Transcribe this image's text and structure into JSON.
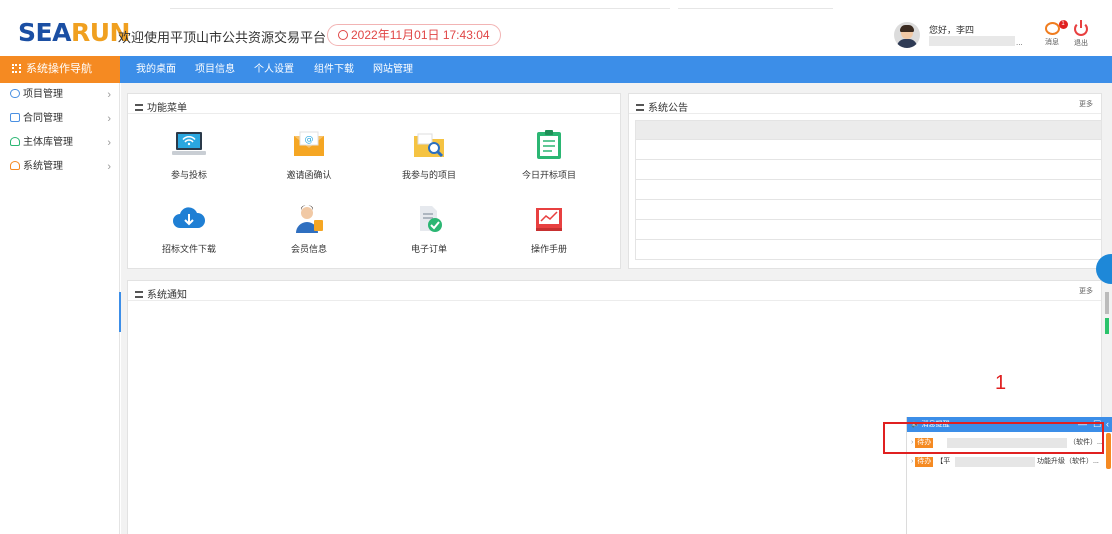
{
  "header": {
    "logo_part1": "SEA",
    "logo_part2": "RUN",
    "welcome": "欢迎使用平顶山市公共资源交易平台",
    "datetime": "2022年11月01日 17:43:04",
    "greeting": "您好，李四",
    "name_suffix": "...",
    "msg_label": "消息",
    "msg_badge": "1",
    "exit_label": "退出"
  },
  "nav": {
    "sidebar_title": "系统操作导航",
    "items": [
      "我的桌面",
      "项目信息",
      "个人设置",
      "组件下载",
      "网站管理"
    ]
  },
  "sidebar": {
    "items": [
      {
        "label": "项目管理",
        "icon": "chat-icon",
        "color": "#4a90e2"
      },
      {
        "label": "合同管理",
        "icon": "document-icon",
        "color": "#4a90e2"
      },
      {
        "label": "主体库管理",
        "icon": "user-icon",
        "color": "#2bb673"
      },
      {
        "label": "系统管理",
        "icon": "users-icon",
        "color": "#f58a22"
      }
    ]
  },
  "function_menu": {
    "title": "功能菜单",
    "tiles": [
      {
        "label": "参与投标",
        "icon": "laptop-wifi-icon"
      },
      {
        "label": "邀请函确认",
        "icon": "envelope-icon"
      },
      {
        "label": "我参与的项目",
        "icon": "folder-search-icon"
      },
      {
        "label": "今日开标项目",
        "icon": "clipboard-icon"
      },
      {
        "label": "招标文件下载",
        "icon": "cloud-download-icon"
      },
      {
        "label": "会员信息",
        "icon": "member-icon"
      },
      {
        "label": "电子订单",
        "icon": "order-check-icon"
      },
      {
        "label": "操作手册",
        "icon": "manual-chart-icon"
      }
    ]
  },
  "announcement": {
    "title": "系统公告",
    "more": "更多"
  },
  "notification": {
    "title": "系统通知",
    "more": "更多"
  },
  "annotation_number": "1",
  "message_popup": {
    "title": "消息提醒",
    "rows": [
      {
        "tag": "待办",
        "prefix": "",
        "suffix": "（软件）..."
      },
      {
        "tag": "待办",
        "prefix": "【平",
        "suffix": "功能升级（软件）..."
      }
    ]
  },
  "colors": {
    "nav_blue": "#3c8ee8",
    "accent_orange": "#f58a22",
    "date_red": "#e04646",
    "highlight_red": "#e02020"
  }
}
